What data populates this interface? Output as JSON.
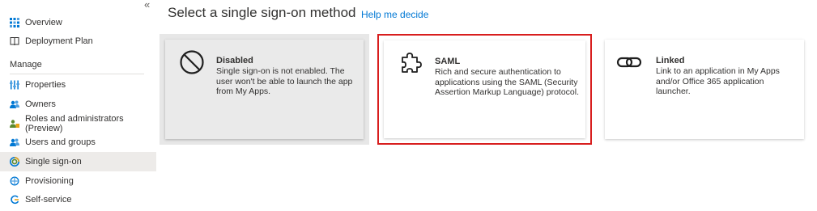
{
  "sidebar": {
    "collapse_glyph": "«",
    "top_items": [
      {
        "label": "Overview",
        "icon": "overview-icon"
      },
      {
        "label": "Deployment Plan",
        "icon": "book-icon"
      }
    ],
    "section_label": "Manage",
    "manage_items": [
      {
        "label": "Properties",
        "icon": "properties-icon"
      },
      {
        "label": "Owners",
        "icon": "owners-icon"
      },
      {
        "label": "Roles and administrators (Preview)",
        "icon": "roles-icon"
      },
      {
        "label": "Users and groups",
        "icon": "users-icon"
      },
      {
        "label": "Single sign-on",
        "icon": "sso-icon",
        "active": true
      },
      {
        "label": "Provisioning",
        "icon": "provisioning-icon"
      },
      {
        "label": "Self-service",
        "icon": "self-service-icon"
      }
    ]
  },
  "header": {
    "title": "Select a single sign-on method",
    "help_link": "Help me decide"
  },
  "cards": {
    "disabled": {
      "title": "Disabled",
      "description": "Single sign-on is not enabled. The user won't be able to launch the app from My Apps.",
      "icon": "prohibited-icon"
    },
    "saml": {
      "title": "SAML",
      "description": "Rich and secure authentication to applications using the SAML (Security Assertion Markup Language) protocol.",
      "icon": "puzzle-icon"
    },
    "linked": {
      "title": "Linked",
      "description": "Link to an application in My Apps and/or Office 365 application launcher.",
      "icon": "link-icon"
    }
  },
  "colors": {
    "accent": "#0078d4",
    "highlight_border": "#d81e1e",
    "active_nav_bg": "#edebe9"
  }
}
